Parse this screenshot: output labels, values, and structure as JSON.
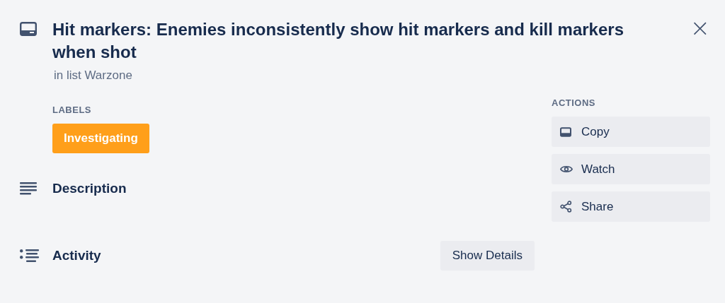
{
  "card": {
    "title": "Hit markers: Enemies inconsistently show hit markers and kill markers when shot",
    "subtitle": "in list Warzone"
  },
  "close": {
    "text": "×"
  },
  "labels": {
    "heading": "LABELS",
    "items": [
      {
        "text": "Investigating",
        "color": "#ff9f1a"
      }
    ]
  },
  "sections": [
    {
      "kind": "description",
      "title": "Description"
    },
    {
      "kind": "activity",
      "title": "Activity",
      "button": "Show Details"
    }
  ],
  "actions": {
    "heading": "ACTIONS",
    "buttons": [
      {
        "kind": "copy",
        "label": "Copy"
      },
      {
        "kind": "watch",
        "label": "Watch"
      },
      {
        "kind": "share",
        "label": "Share"
      }
    ]
  }
}
